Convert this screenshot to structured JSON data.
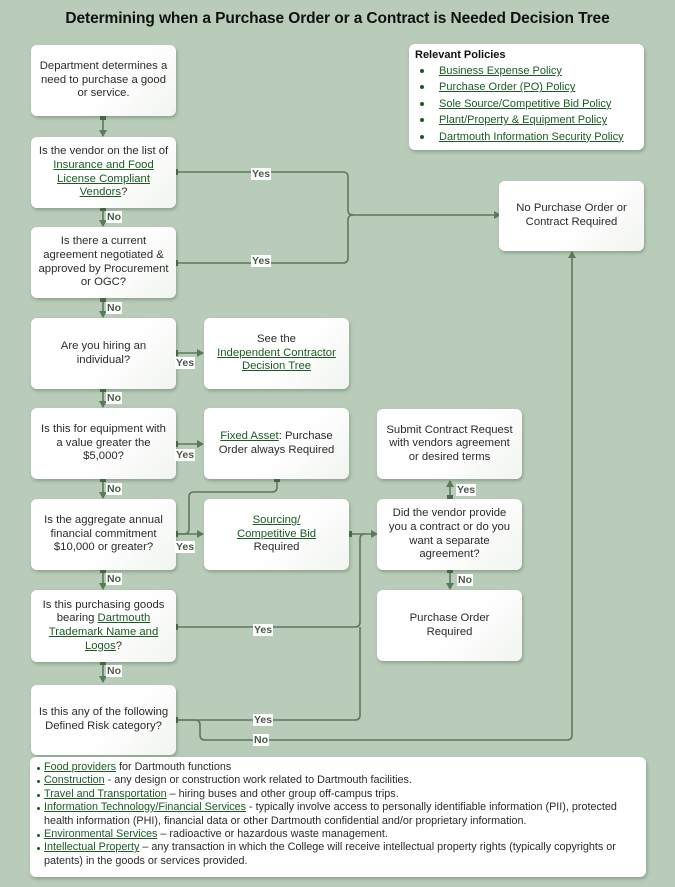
{
  "title": "Determining when a Purchase Order or a Contract is Needed Decision Tree",
  "colors": {
    "background": "#b9cbb9",
    "connector": "#5b7a5b",
    "link": "#1d5a25",
    "box": "#ffffff"
  },
  "policies": {
    "heading": "Relevant Policies",
    "items": [
      "Business Expense Policy",
      "Purchase Order (PO) Policy",
      "Sole Source/Competitive Bid Policy",
      "Plant/Property & Equipment Policy",
      "Dartmouth Information Security Policy"
    ]
  },
  "nodes": {
    "start": {
      "text": "Department determines a need to purchase a good or service."
    },
    "q_vendor_list": {
      "pre": "Is the vendor on the list of ",
      "link": "Insurance and Food License Compliant Vendors",
      "post": "?"
    },
    "q_agreement": {
      "text": "Is there a current agreement negotiated & approved by Procurement or OGC?"
    },
    "q_individual": {
      "text": "Are you hiring an individual?"
    },
    "r_independent": {
      "pre": "See the",
      "link": "Independent Contractor Decision Tree"
    },
    "q_equipment": {
      "text": "Is this for equipment with a value greater the $5,000?"
    },
    "r_fixed_asset": {
      "link": "Fixed Asset",
      "post": ": Purchase Order always Required"
    },
    "q_aggregate": {
      "text": "Is the aggregate annual financial commitment $10,000 or greater?"
    },
    "r_sourcing": {
      "link": "Sourcing/ Competitive Bid",
      "post": "Required"
    },
    "q_trademark": {
      "pre": "Is this purchasing goods bearing ",
      "link": "Dartmouth Trademark Name and Logos",
      "post": "?"
    },
    "q_defined_risk": {
      "text": "Is this any of the following Defined Risk category?"
    },
    "r_no_po": {
      "text": "No Purchase Order or Contract Required"
    },
    "r_submit_contract": {
      "text": "Submit Contract Request with vendors agreement or desired terms"
    },
    "q_vendor_contract": {
      "text": "Did the vendor provide you a contract or do you want a separate agreement?"
    },
    "r_po_required": {
      "text": "Purchase Order Required"
    }
  },
  "edge_labels": {
    "yes": "Yes",
    "no": "No"
  },
  "risk_categories": [
    {
      "link": "Food providers",
      "desc": " for Dartmouth functions"
    },
    {
      "link": "Construction",
      "desc": " - any design or construction work related to Dartmouth facilities."
    },
    {
      "link": "Travel and Transportation",
      "desc": " – hiring buses and other group off-campus trips."
    },
    {
      "link": "Information Technology/Financial Services",
      "desc": " - typically involve access to personally identifiable information (PII), protected health information (PHI), financial data or other Dartmouth confidential and/or proprietary information."
    },
    {
      "link": "Environmental Services",
      "desc": " – radioactive or hazardous waste management."
    },
    {
      "link": "Intellectual Property",
      "desc": " – any transaction in which the College will receive intellectual property rights (typically copyrights or patents) in the goods or services provided."
    }
  ]
}
